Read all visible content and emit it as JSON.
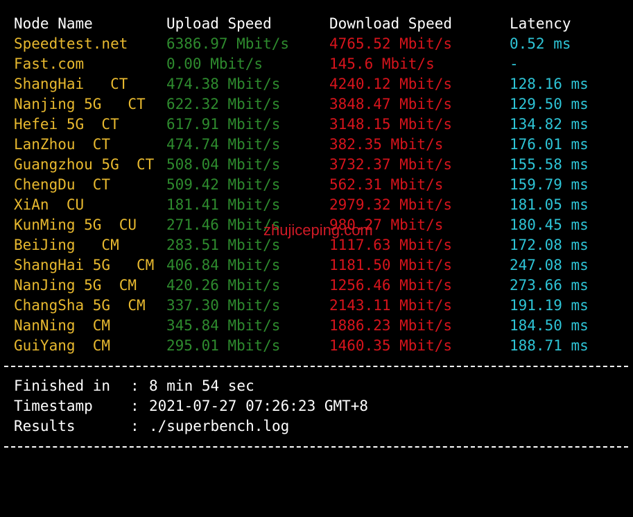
{
  "header": {
    "node_name": "Node Name",
    "upload_speed": "Upload Speed",
    "download_speed": "Download Speed",
    "latency": "Latency"
  },
  "rows": [
    {
      "node": "Speedtest.net",
      "upload": "6386.97 Mbit/s",
      "download": "4765.52 Mbit/s",
      "latency": "0.52 ms"
    },
    {
      "node": "Fast.com",
      "upload": "0.00 Mbit/s",
      "download": "145.6 Mbit/s",
      "latency": "-"
    },
    {
      "node": "ShangHai   CT",
      "upload": "474.38 Mbit/s",
      "download": "4240.12 Mbit/s",
      "latency": "128.16 ms"
    },
    {
      "node": "Nanjing 5G   CT",
      "upload": "622.32 Mbit/s",
      "download": "3848.47 Mbit/s",
      "latency": "129.50 ms"
    },
    {
      "node": "Hefei 5G  CT",
      "upload": "617.91 Mbit/s",
      "download": "3148.15 Mbit/s",
      "latency": "134.82 ms"
    },
    {
      "node": "LanZhou  CT",
      "upload": "474.74 Mbit/s",
      "download": "382.35 Mbit/s",
      "latency": "176.01 ms"
    },
    {
      "node": "Guangzhou 5G  CT",
      "upload": "508.04 Mbit/s",
      "download": "3732.37 Mbit/s",
      "latency": "155.58 ms"
    },
    {
      "node": "ChengDu  CT",
      "upload": "509.42 Mbit/s",
      "download": "562.31 Mbit/s",
      "latency": "159.79 ms"
    },
    {
      "node": "XiAn  CU",
      "upload": "181.41 Mbit/s",
      "download": "2979.32 Mbit/s",
      "latency": "181.05 ms"
    },
    {
      "node": "KunMing 5G  CU",
      "upload": "271.46 Mbit/s",
      "download": "980.27 Mbit/s",
      "latency": "180.45 ms"
    },
    {
      "node": "BeiJing   CM",
      "upload": "283.51 Mbit/s",
      "download": "1117.63 Mbit/s",
      "latency": "172.08 ms"
    },
    {
      "node": "ShangHai 5G   CM",
      "upload": "406.84 Mbit/s",
      "download": "1181.50 Mbit/s",
      "latency": "247.08 ms"
    },
    {
      "node": "NanJing 5G  CM",
      "upload": "420.26 Mbit/s",
      "download": "1256.46 Mbit/s",
      "latency": "273.66 ms"
    },
    {
      "node": "ChangSha 5G  CM",
      "upload": "337.30 Mbit/s",
      "download": "2143.11 Mbit/s",
      "latency": "191.19 ms"
    },
    {
      "node": "NanNing  CM",
      "upload": "345.84 Mbit/s",
      "download": "1886.23 Mbit/s",
      "latency": "184.50 ms"
    },
    {
      "node": "GuiYang  CM",
      "upload": "295.01 Mbit/s",
      "download": "1460.35 Mbit/s",
      "latency": "188.71 ms"
    }
  ],
  "summary": {
    "finished_label": "Finished in",
    "finished_value": "8 min 54 sec",
    "timestamp_label": "Timestamp",
    "timestamp_value": "2021-07-27 07:26:23 GMT+8",
    "results_label": "Results",
    "results_value": "./superbench.log",
    "separator": ":"
  },
  "watermark": "zhujiceping.com",
  "colors": {
    "background": "#000000",
    "header_text": "#ffffff",
    "node_name": "#e8b92f",
    "upload": "#2e8b2e",
    "download": "#d7141c",
    "latency": "#2ec4d6",
    "watermark": "#e11d2a"
  }
}
